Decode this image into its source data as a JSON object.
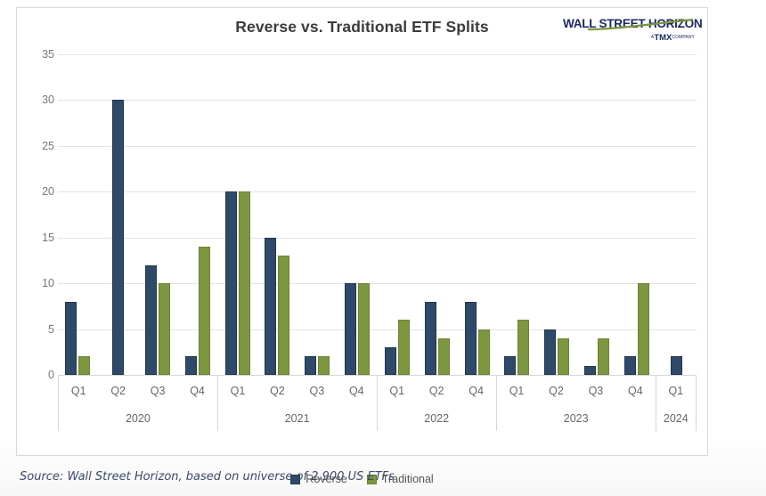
{
  "chart": {
    "title": "Reverse vs. Traditional ETF Splits",
    "source_note": "Source: Wall Street Horizon, based on universe of 2,900 US ETFs",
    "logo": {
      "wordmark": "WALL STREET HORIZON",
      "tmx_prefix": "A",
      "tmx_main": "TMX",
      "tmx_suffix": "COMPANY"
    },
    "legend": [
      {
        "label": "Reverse",
        "color": "#2f4a68"
      },
      {
        "label": "Traditional",
        "color": "#7d9640"
      }
    ]
  },
  "chart_data": {
    "type": "bar",
    "title": "Reverse vs. Traditional ETF Splits",
    "xlabel": "",
    "ylabel": "",
    "ylim": [
      0,
      35
    ],
    "yticks": [
      0,
      5,
      10,
      15,
      20,
      25,
      30,
      35
    ],
    "grid": true,
    "legend_position": "bottom",
    "categories": [
      "2020 Q1",
      "2020 Q2",
      "2020 Q3",
      "2020 Q4",
      "2021 Q1",
      "2021 Q2",
      "2021 Q3",
      "2021 Q4",
      "2022 Q1",
      "2022 Q2",
      "2022 Q4",
      "2023 Q1",
      "2023 Q2",
      "2023 Q3",
      "2023 Q4",
      "2024 Q1"
    ],
    "year_groups": [
      {
        "year": "2020",
        "quarters": [
          "Q1",
          "Q2",
          "Q3",
          "Q4"
        ]
      },
      {
        "year": "2021",
        "quarters": [
          "Q1",
          "Q2",
          "Q3",
          "Q4"
        ]
      },
      {
        "year": "2022",
        "quarters": [
          "Q1",
          "Q2",
          "Q4"
        ]
      },
      {
        "year": "2023",
        "quarters": [
          "Q1",
          "Q2",
          "Q3",
          "Q4"
        ]
      },
      {
        "year": "2024",
        "quarters": [
          "Q1"
        ]
      }
    ],
    "series": [
      {
        "name": "Reverse",
        "color": "#2f4a68",
        "values": [
          8,
          30,
          12,
          2,
          20,
          15,
          2,
          10,
          3,
          8,
          8,
          2,
          5,
          1,
          2,
          2
        ]
      },
      {
        "name": "Traditional",
        "color": "#7d9640",
        "values": [
          2,
          0,
          10,
          14,
          20,
          13,
          2,
          10,
          6,
          4,
          5,
          6,
          4,
          4,
          10,
          0
        ]
      }
    ]
  }
}
